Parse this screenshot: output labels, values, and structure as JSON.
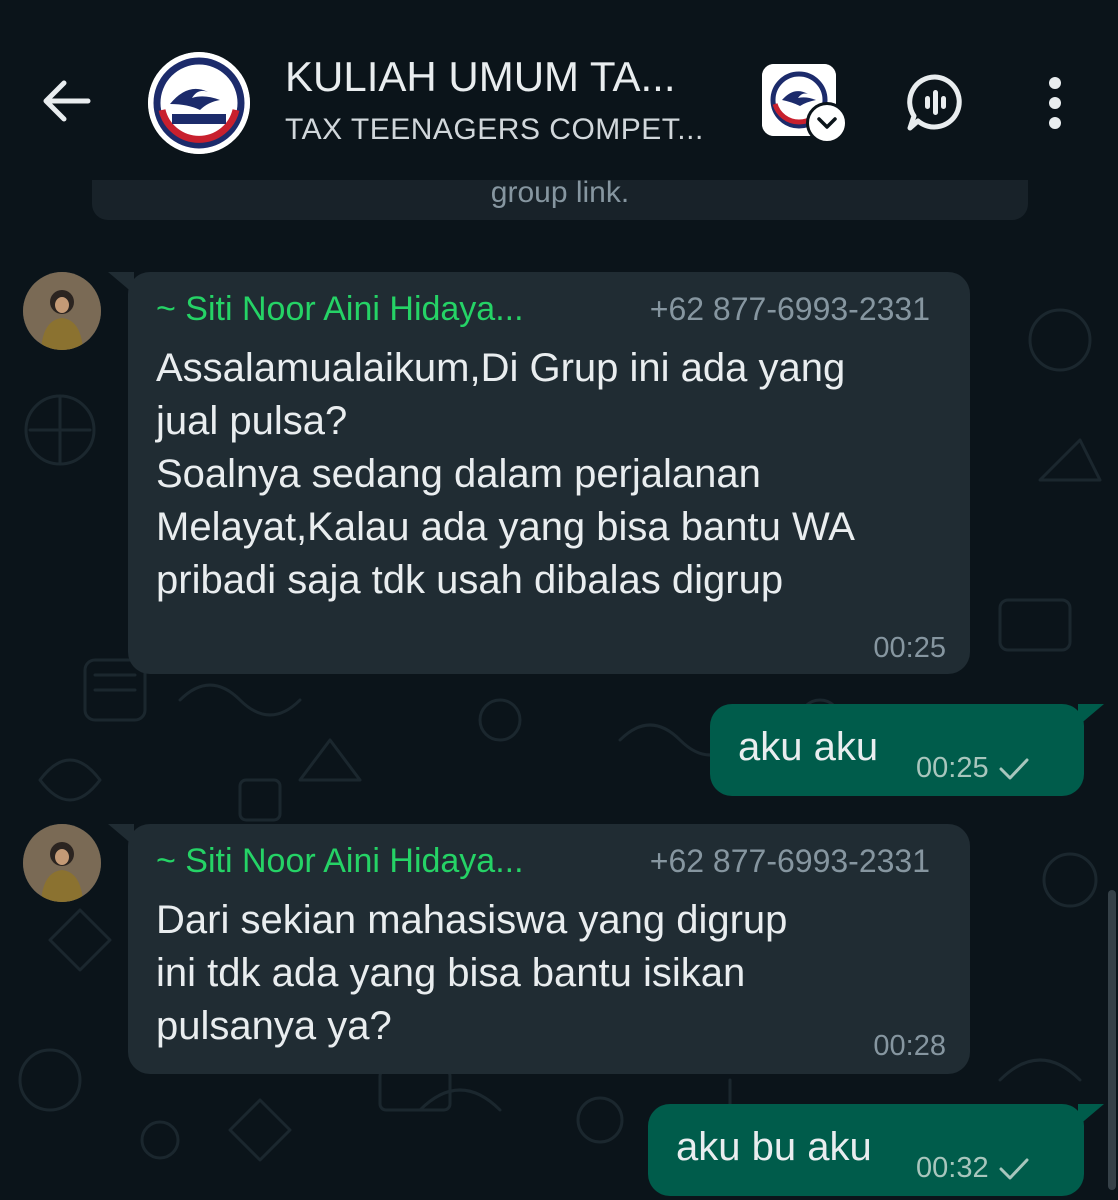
{
  "header": {
    "title": "KULIAH UMUM TA...",
    "subtitle": "TAX TEENAGERS COMPET...",
    "avatar_icon": "tax-teenagers-logo",
    "back_icon": "arrow-left",
    "voice_icon": "voice-chat",
    "menu_icon": "more-vertical"
  },
  "chat": {
    "system_note": "group link.",
    "messages": [
      {
        "direction": "in",
        "sender": "~ Siti Noor Aini Hidaya...",
        "phone": "+62 877-6993-2331",
        "text": "Assalamualaikum,Di Grup ini ada yang\njual pulsa?\nSoalnya sedang dalam perjalanan\nMelayat,Kalau ada yang bisa bantu WA\npribadi saja tdk usah dibalas digrup",
        "time": "00:25"
      },
      {
        "direction": "out",
        "text": "aku aku",
        "time": "00:25",
        "status": "sent"
      },
      {
        "direction": "in",
        "sender": "~ Siti Noor Aini Hidaya...",
        "phone": "+62 877-6993-2331",
        "text": "Dari sekian mahasiswa yang digrup\nini tdk ada yang bisa bantu isikan\npulsanya ya?",
        "time": "00:28"
      },
      {
        "direction": "out",
        "text": "aku bu aku",
        "time": "00:32",
        "status": "sent"
      }
    ]
  },
  "colors": {
    "background": "#0b141a",
    "incoming_bubble": "#202c33",
    "outgoing_bubble": "#005c4b",
    "sender_name": "#25d366",
    "meta_text": "#8696a0"
  }
}
